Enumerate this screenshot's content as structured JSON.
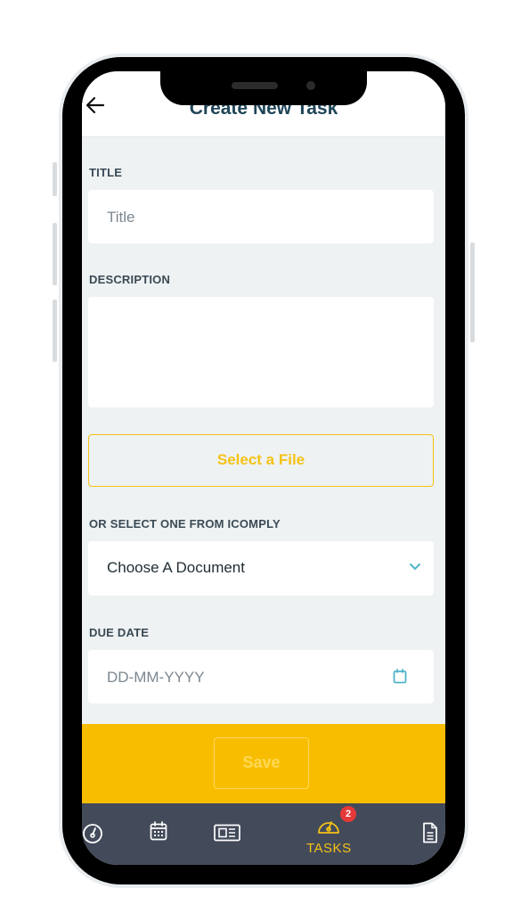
{
  "header": {
    "title": "Create New Task"
  },
  "form": {
    "title_label": "TITLE",
    "title_placeholder": "Title",
    "description_label": "DESCRIPTION",
    "select_file_label": "Select a File",
    "icomply_label": "OR SELECT ONE FROM ICOMPLY",
    "document_select_value": "Choose A Document",
    "due_date_label": "DUE DATE",
    "due_date_placeholder": "DD-MM-YYYY",
    "save_label": "Save"
  },
  "tabbar": {
    "active_tab": "tasks",
    "tasks_label": "TASKS",
    "tasks_badge": "2",
    "icons": [
      "dashboard-icon",
      "calendar-icon",
      "news-icon",
      "tasks-gauge-icon",
      "document-icon"
    ]
  },
  "colors": {
    "accent": "#f5c216",
    "save_bar": "#f9bd00",
    "tabbar": "#434a5a",
    "badge": "#e53939",
    "title": "#1f4557",
    "background": "#eef2f3"
  }
}
